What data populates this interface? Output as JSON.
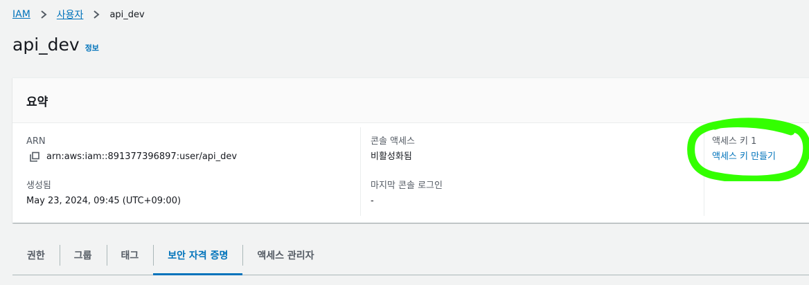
{
  "breadcrumb": {
    "items": [
      "IAM",
      "사용자"
    ],
    "current": "api_dev"
  },
  "header": {
    "title": "api_dev",
    "info_link": "정보"
  },
  "summary": {
    "title": "요약",
    "arn_label": "ARN",
    "arn_value": "arn:aws:iam::891377396897:user/api_dev",
    "created_label": "생성됨",
    "created_value": "May 23, 2024, 09:45 (UTC+09:00)",
    "console_access_label": "콘솔 액세스",
    "console_access_value": "비활성화됨",
    "last_login_label": "마지막 콘솔 로그인",
    "last_login_value": "-",
    "access_key_label": "액세스 키 1",
    "access_key_action": "액세스 키 만들기"
  },
  "tabs": [
    "권한",
    "그룹",
    "태그",
    "보안 자격 증명",
    "액세스 관리자"
  ],
  "active_tab": "보안 자격 증명",
  "colors": {
    "link": "#0073bb",
    "annotation": "#33ff00"
  },
  "icons": [
    "chevron-right-icon",
    "copy-icon"
  ]
}
